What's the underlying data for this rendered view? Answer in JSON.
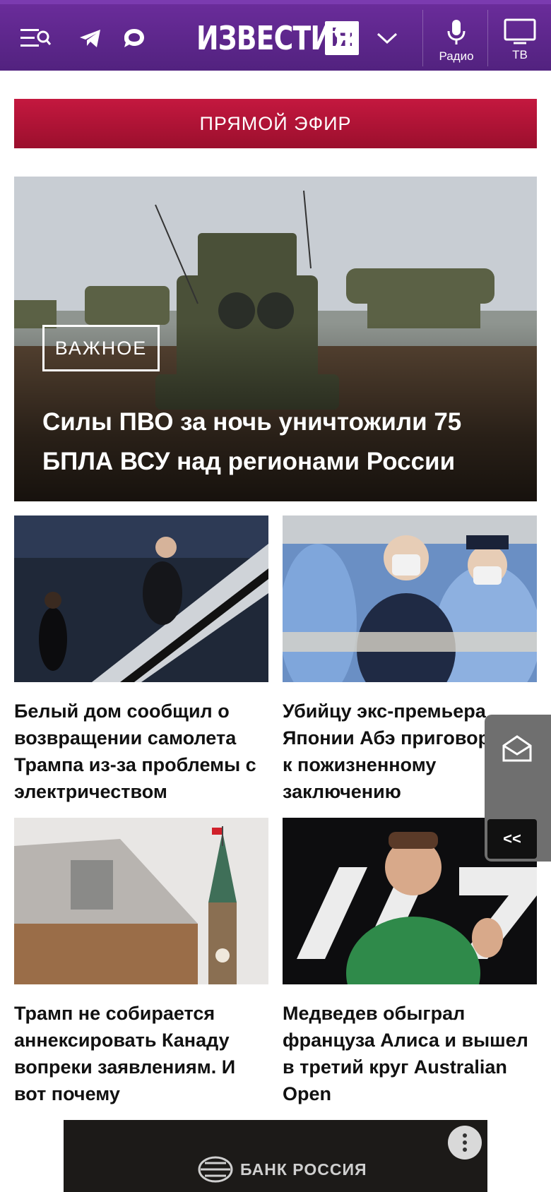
{
  "header": {
    "logo_text": "ИЗВЕСТИЯ",
    "logo_badge": "iz",
    "radio_label": "Радио",
    "tv_label": "ТВ",
    "icons": [
      "menu-search-icon",
      "telegram-icon",
      "chat-icon",
      "chevron-down-icon",
      "microphone-icon",
      "tv-icon"
    ]
  },
  "live_button": "ПРЯМОЙ ЭФИР",
  "hero": {
    "badge": "ВАЖНОЕ",
    "title": "Силы ПВО за ночь уничтожили 75 БПЛА ВСУ над регионами России"
  },
  "cards": [
    {
      "title": "Белый дом сообщил о возвращении самолета Трампа из-за проблемы с электричеством"
    },
    {
      "title": "Убийцу экс-премьера Японии Абэ приговорили к пожизненному заключению"
    },
    {
      "title": "Трамп не собирается аннексировать Канаду вопреки заявлениям. И вот почему"
    },
    {
      "title": "Медведев обыграл француза Алиса и вышел в третий круг Australian Open"
    }
  ],
  "side_widget": {
    "collapse_label": "<<"
  },
  "ad": {
    "brand": "БАНК РОССИЯ"
  },
  "colors": {
    "header": "#5b2588",
    "live": "#b0143a",
    "text": "#111111"
  }
}
